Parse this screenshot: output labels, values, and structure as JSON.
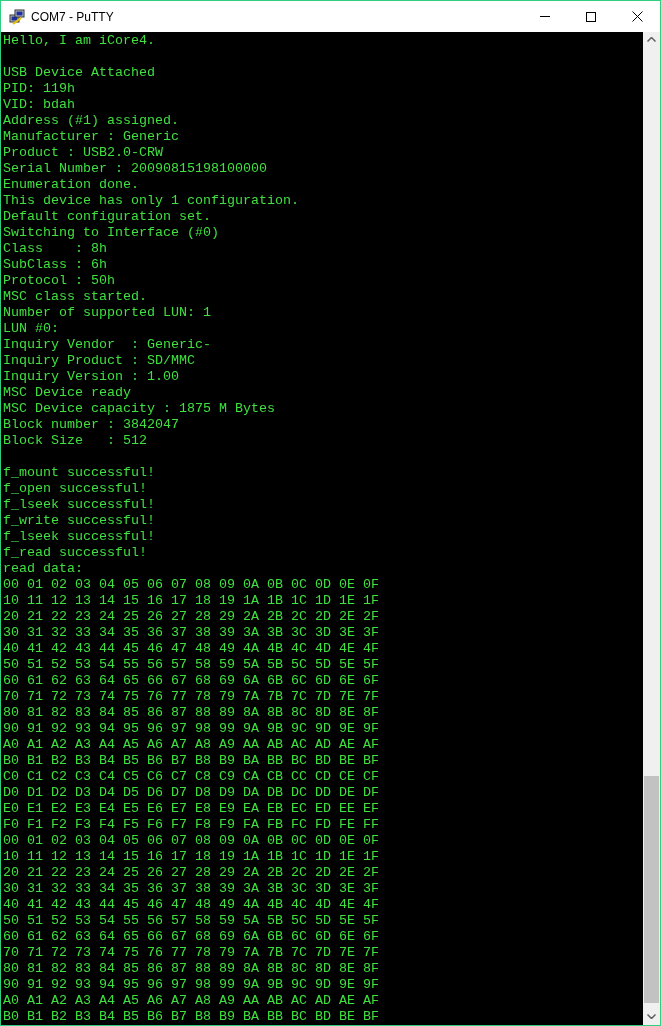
{
  "window": {
    "title": "COM7 - PuTTY"
  },
  "terminal": {
    "lines": [
      {
        "kind": "text",
        "text": "Hello, I am iCore4."
      },
      {
        "kind": "blank"
      },
      {
        "kind": "text",
        "text": "USB Device Attached"
      },
      {
        "kind": "text",
        "text": "PID: 119h"
      },
      {
        "kind": "text",
        "text": "VID: bdah"
      },
      {
        "kind": "text",
        "text": "Address (#1) assigned."
      },
      {
        "kind": "text",
        "text": "Manufacturer : Generic"
      },
      {
        "kind": "text",
        "text": "Product : USB2.0-CRW"
      },
      {
        "kind": "text",
        "text": "Serial Number : 20090815198100000"
      },
      {
        "kind": "text",
        "text": "Enumeration done."
      },
      {
        "kind": "text",
        "text": "This device has only 1 configuration."
      },
      {
        "kind": "text",
        "text": "Default configuration set."
      },
      {
        "kind": "text",
        "text": "Switching to Interface (#0)"
      },
      {
        "kind": "text",
        "text": "Class    : 8h"
      },
      {
        "kind": "text",
        "text": "SubClass : 6h"
      },
      {
        "kind": "text",
        "text": "Protocol : 50h"
      },
      {
        "kind": "text",
        "text": "MSC class started."
      },
      {
        "kind": "text",
        "text": "Number of supported LUN: 1"
      },
      {
        "kind": "text",
        "text": "LUN #0:"
      },
      {
        "kind": "text",
        "text": "Inquiry Vendor  : Generic-"
      },
      {
        "kind": "text",
        "text": "Inquiry Product : SD/MMC"
      },
      {
        "kind": "text",
        "text": "Inquiry Version : 1.00"
      },
      {
        "kind": "text",
        "text": "MSC Device ready"
      },
      {
        "kind": "text",
        "text": "MSC Device capacity : 1875 M Bytes"
      },
      {
        "kind": "text",
        "text": "Block number : 3842047"
      },
      {
        "kind": "text",
        "text": "Block Size   : 512"
      },
      {
        "kind": "blank"
      },
      {
        "kind": "text",
        "text": "f_mount successful!"
      },
      {
        "kind": "text",
        "text": "f_open successful!"
      },
      {
        "kind": "text",
        "text": "f_lseek successful!"
      },
      {
        "kind": "text",
        "text": "f_write successful!"
      },
      {
        "kind": "text",
        "text": "f_lseek successful!"
      },
      {
        "kind": "text",
        "text": "f_read successful!"
      },
      {
        "kind": "text",
        "text": "read data:"
      },
      {
        "kind": "text",
        "text": "00 01 02 03 04 05 06 07 08 09 0A 0B 0C 0D 0E 0F"
      },
      {
        "kind": "text",
        "text": "10 11 12 13 14 15 16 17 18 19 1A 1B 1C 1D 1E 1F"
      },
      {
        "kind": "text",
        "text": "20 21 22 23 24 25 26 27 28 29 2A 2B 2C 2D 2E 2F"
      },
      {
        "kind": "text",
        "text": "30 31 32 33 34 35 36 37 38 39 3A 3B 3C 3D 3E 3F"
      },
      {
        "kind": "text",
        "text": "40 41 42 43 44 45 46 47 48 49 4A 4B 4C 4D 4E 4F"
      },
      {
        "kind": "text",
        "text": "50 51 52 53 54 55 56 57 58 59 5A 5B 5C 5D 5E 5F"
      },
      {
        "kind": "text",
        "text": "60 61 62 63 64 65 66 67 68 69 6A 6B 6C 6D 6E 6F"
      },
      {
        "kind": "text",
        "text": "70 71 72 73 74 75 76 77 78 79 7A 7B 7C 7D 7E 7F"
      },
      {
        "kind": "text",
        "text": "80 81 82 83 84 85 86 87 88 89 8A 8B 8C 8D 8E 8F"
      },
      {
        "kind": "text",
        "text": "90 91 92 93 94 95 96 97 98 99 9A 9B 9C 9D 9E 9F"
      },
      {
        "kind": "text",
        "text": "A0 A1 A2 A3 A4 A5 A6 A7 A8 A9 AA AB AC AD AE AF"
      },
      {
        "kind": "text",
        "text": "B0 B1 B2 B3 B4 B5 B6 B7 B8 B9 BA BB BC BD BE BF"
      },
      {
        "kind": "text",
        "text": "C0 C1 C2 C3 C4 C5 C6 C7 C8 C9 CA CB CC CD CE CF"
      },
      {
        "kind": "text",
        "text": "D0 D1 D2 D3 D4 D5 D6 D7 D8 D9 DA DB DC DD DE DF"
      },
      {
        "kind": "text",
        "text": "E0 E1 E2 E3 E4 E5 E6 E7 E8 E9 EA EB EC ED EE EF"
      },
      {
        "kind": "text",
        "text": "F0 F1 F2 F3 F4 F5 F6 F7 F8 F9 FA FB FC FD FE FF"
      },
      {
        "kind": "text",
        "text": "00 01 02 03 04 05 06 07 08 09 0A 0B 0C 0D 0E 0F"
      },
      {
        "kind": "text",
        "text": "10 11 12 13 14 15 16 17 18 19 1A 1B 1C 1D 1E 1F"
      },
      {
        "kind": "text",
        "text": "20 21 22 23 24 25 26 27 28 29 2A 2B 2C 2D 2E 2F"
      },
      {
        "kind": "text",
        "text": "30 31 32 33 34 35 36 37 38 39 3A 3B 3C 3D 3E 3F"
      },
      {
        "kind": "text",
        "text": "40 41 42 43 44 45 46 47 48 49 4A 4B 4C 4D 4E 4F"
      },
      {
        "kind": "text",
        "text": "50 51 52 53 54 55 56 57 58 59 5A 5B 5C 5D 5E 5F"
      },
      {
        "kind": "text",
        "text": "60 61 62 63 64 65 66 67 68 69 6A 6B 6C 6D 6E 6F"
      },
      {
        "kind": "text",
        "text": "70 71 72 73 74 75 76 77 78 79 7A 7B 7C 7D 7E 7F"
      },
      {
        "kind": "text",
        "text": "80 81 82 83 84 85 86 87 88 89 8A 8B 8C 8D 8E 8F"
      },
      {
        "kind": "text",
        "text": "90 91 92 93 94 95 96 97 98 99 9A 9B 9C 9D 9E 9F"
      },
      {
        "kind": "text",
        "text": "A0 A1 A2 A3 A4 A5 A6 A7 A8 A9 AA AB AC AD AE AF"
      },
      {
        "kind": "text",
        "text": "B0 B1 B2 B3 B4 B5 B6 B7 B8 B9 BA BB BC BD BE BF"
      }
    ]
  }
}
